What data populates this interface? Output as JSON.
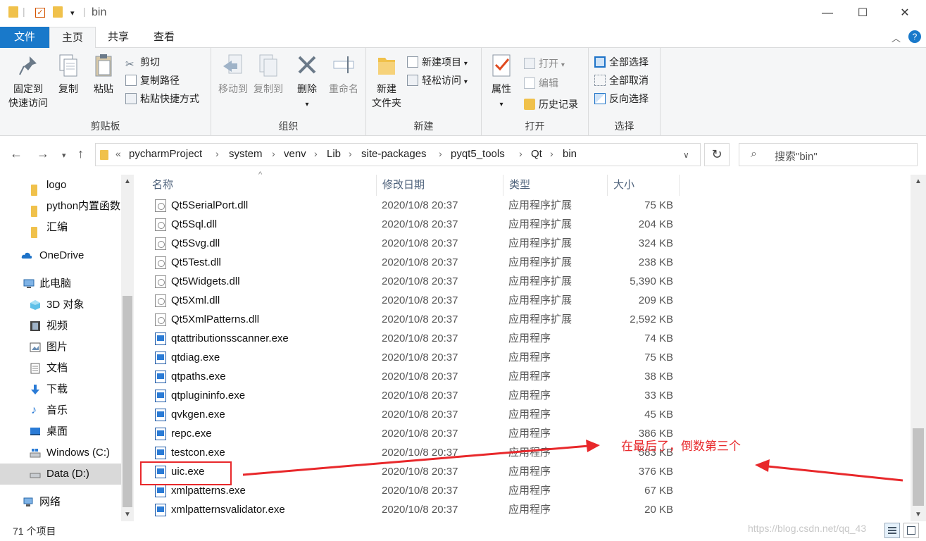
{
  "window": {
    "title": "bin",
    "controls": {
      "minimize": "—",
      "maximize": "☐",
      "close": "✕"
    }
  },
  "ribbon_tabs": [
    "文件",
    "主页",
    "共享",
    "查看"
  ],
  "ribbon": {
    "clipboard": {
      "label": "剪贴板",
      "pin": [
        "固定到",
        "快速访问"
      ],
      "copy": "复制",
      "paste": "粘贴",
      "cut": "剪切",
      "copy_path": "复制路径",
      "paste_shortcut": "粘贴快捷方式"
    },
    "organize": {
      "label": "组织",
      "move_to": "移动到",
      "copy_to": "复制到",
      "delete": "删除",
      "rename": "重命名"
    },
    "new": {
      "label": "新建",
      "new_folder": [
        "新建",
        "文件夹"
      ],
      "new_item": "新建项目",
      "easy_access": "轻松访问"
    },
    "open": {
      "label": "打开",
      "properties": "属性",
      "open": "打开",
      "edit": "编辑",
      "history": "历史记录"
    },
    "select": {
      "label": "选择",
      "select_all": "全部选择",
      "select_none": "全部取消",
      "invert": "反向选择"
    }
  },
  "address": {
    "prefix": "«",
    "crumbs": [
      "pycharmProject",
      "system",
      "venv",
      "Lib",
      "site-packages",
      "pyqt5_tools",
      "Qt",
      "bin"
    ],
    "separator": "›",
    "search_placeholder": "搜索\"bin\""
  },
  "nav_items": [
    {
      "label": "logo",
      "icon": "folder-icon"
    },
    {
      "label": "python内置函数",
      "icon": "folder-icon"
    },
    {
      "label": "汇编",
      "icon": "folder-icon"
    },
    {
      "label": "OneDrive",
      "icon": "cloud-icon"
    },
    {
      "label": "此电脑",
      "icon": "computer-icon"
    },
    {
      "label": "3D 对象",
      "icon": "cube-icon"
    },
    {
      "label": "视频",
      "icon": "video-icon"
    },
    {
      "label": "图片",
      "icon": "pictures-icon"
    },
    {
      "label": "文档",
      "icon": "documents-icon"
    },
    {
      "label": "下载",
      "icon": "download-icon"
    },
    {
      "label": "音乐",
      "icon": "music-icon"
    },
    {
      "label": "桌面",
      "icon": "desktop-icon"
    },
    {
      "label": "Windows (C:)",
      "icon": "drive-icon"
    },
    {
      "label": "Data (D:)",
      "icon": "drive-icon"
    },
    {
      "label": "网络",
      "icon": "network-icon"
    }
  ],
  "columns": [
    "名称",
    "修改日期",
    "类型",
    "大小"
  ],
  "files": [
    {
      "name": "Qt5SerialPort.dll",
      "date": "2020/10/8 20:37",
      "type": "应用程序扩展",
      "size": "75 KB",
      "kind": "dll"
    },
    {
      "name": "Qt5Sql.dll",
      "date": "2020/10/8 20:37",
      "type": "应用程序扩展",
      "size": "204 KB",
      "kind": "dll"
    },
    {
      "name": "Qt5Svg.dll",
      "date": "2020/10/8 20:37",
      "type": "应用程序扩展",
      "size": "324 KB",
      "kind": "dll"
    },
    {
      "name": "Qt5Test.dll",
      "date": "2020/10/8 20:37",
      "type": "应用程序扩展",
      "size": "238 KB",
      "kind": "dll"
    },
    {
      "name": "Qt5Widgets.dll",
      "date": "2020/10/8 20:37",
      "type": "应用程序扩展",
      "size": "5,390 KB",
      "kind": "dll"
    },
    {
      "name": "Qt5Xml.dll",
      "date": "2020/10/8 20:37",
      "type": "应用程序扩展",
      "size": "209 KB",
      "kind": "dll"
    },
    {
      "name": "Qt5XmlPatterns.dll",
      "date": "2020/10/8 20:37",
      "type": "应用程序扩展",
      "size": "2,592 KB",
      "kind": "dll"
    },
    {
      "name": "qtattributionsscanner.exe",
      "date": "2020/10/8 20:37",
      "type": "应用程序",
      "size": "74 KB",
      "kind": "exe"
    },
    {
      "name": "qtdiag.exe",
      "date": "2020/10/8 20:37",
      "type": "应用程序",
      "size": "75 KB",
      "kind": "exe"
    },
    {
      "name": "qtpaths.exe",
      "date": "2020/10/8 20:37",
      "type": "应用程序",
      "size": "38 KB",
      "kind": "exe"
    },
    {
      "name": "qtplugininfo.exe",
      "date": "2020/10/8 20:37",
      "type": "应用程序",
      "size": "33 KB",
      "kind": "exe"
    },
    {
      "name": "qvkgen.exe",
      "date": "2020/10/8 20:37",
      "type": "应用程序",
      "size": "45 KB",
      "kind": "exe"
    },
    {
      "name": "repc.exe",
      "date": "2020/10/8 20:37",
      "type": "应用程序",
      "size": "386 KB",
      "kind": "exe"
    },
    {
      "name": "testcon.exe",
      "date": "2020/10/8 20:37",
      "type": "应用程序",
      "size": "583 KB",
      "kind": "exe"
    },
    {
      "name": "uic.exe",
      "date": "2020/10/8 20:37",
      "type": "应用程序",
      "size": "376 KB",
      "kind": "exe"
    },
    {
      "name": "xmlpatterns.exe",
      "date": "2020/10/8 20:37",
      "type": "应用程序",
      "size": "67 KB",
      "kind": "exe"
    },
    {
      "name": "xmlpatternsvalidator.exe",
      "date": "2020/10/8 20:37",
      "type": "应用程序",
      "size": "20 KB",
      "kind": "exe"
    }
  ],
  "status": {
    "count": "71 个项目"
  },
  "annotation": {
    "text": "在最后了，倒数第三个",
    "color": "#e8282b"
  },
  "watermark": "https://blog.csdn.net/qq_43"
}
